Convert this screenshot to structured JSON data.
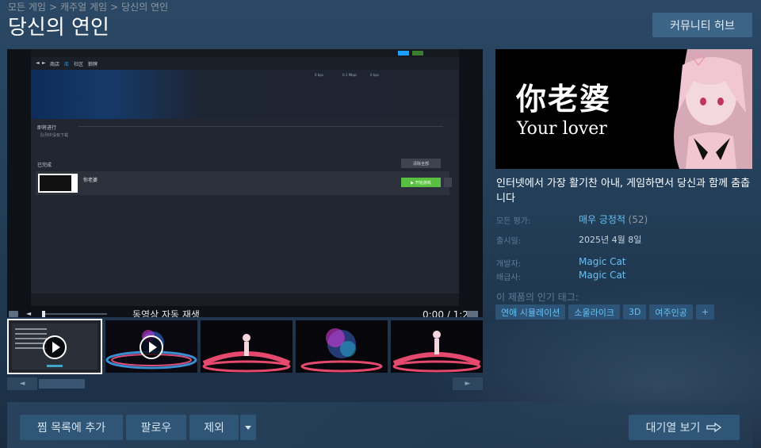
{
  "breadcrumb": {
    "items": [
      "모든 게임",
      "캐주얼 게임",
      "당신의 연인"
    ],
    "separator": ">"
  },
  "page_title": "당신의 연인",
  "header": {
    "community_hub_label": "커뮤니티 허브"
  },
  "media": {
    "player": {
      "screenshot": {
        "nav_items": [
          "商店",
          "库",
          "社区",
          "狼牌"
        ],
        "stats": [
          "0 bps",
          "0.3 Mbps",
          "0 bps"
        ],
        "section_upcoming": "即将进行",
        "section_upcoming_sub": "队列中没有下载",
        "section_completed": "已完成",
        "clear_all_label": "清除全部",
        "game_name": "你老婆",
        "play_button_label": "▶ 开始游戏"
      },
      "caption": "동영상 자동 재생",
      "time": "0:00 / 1:29"
    },
    "thumbnails": [
      {
        "type": "video",
        "active": true
      },
      {
        "type": "video",
        "active": false
      },
      {
        "type": "image",
        "active": false
      },
      {
        "type": "image",
        "active": false
      },
      {
        "type": "image",
        "active": false
      }
    ],
    "scroll": {
      "left_arrow": "◄",
      "right_arrow": "►"
    }
  },
  "capsule": {
    "title_cn": "你老婆",
    "title_en": "Your lover"
  },
  "description": "인터넷에서 가장 활기찬 아내, 게임하면서 당신과 함께 춤춥니다",
  "info": {
    "review_label": "모든 평가:",
    "review_value": "매우 긍정적",
    "review_count": "(52)",
    "release_label": "출시일:",
    "release_value": "2025년 4월 8일",
    "developer_label": "개발자:",
    "developer_value": "Magic Cat",
    "publisher_label": "배급사:",
    "publisher_value": "Magic Cat"
  },
  "tags": {
    "label": "이 제품의 인기 태그:",
    "items": [
      "연애 시뮬레이션",
      "소울라이크",
      "3D",
      "여주인공",
      "+"
    ]
  },
  "actions": {
    "wishlist_label": "찜 목록에 추가",
    "follow_label": "팔로우",
    "ignore_label": "제외",
    "queue_label": "대기열 보기"
  },
  "colors": {
    "accent_link": "#66c0f4",
    "button_bg": "#2f5677",
    "tag_bg": "#2d5377",
    "play_green": "#59bf40"
  }
}
